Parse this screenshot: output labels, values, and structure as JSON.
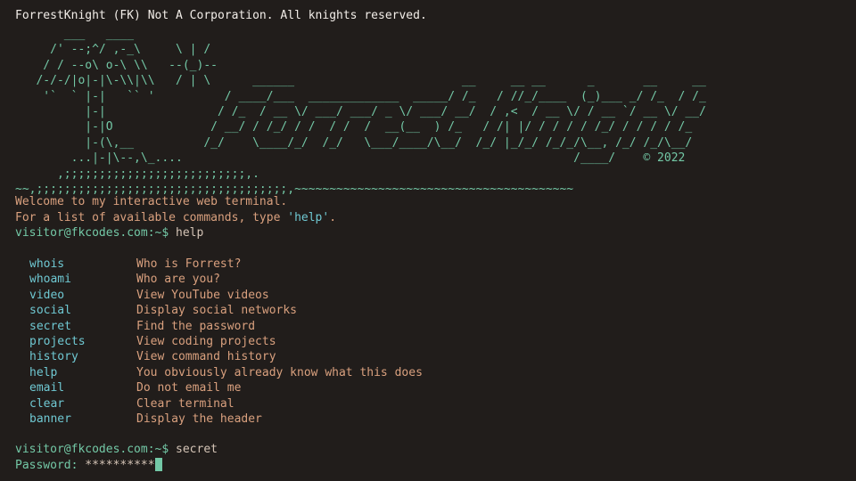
{
  "banner": {
    "copyright_line": "ForrestKnight (FK) Not A Corporation. All knights reserved.",
    "ascii_art": "       ___   ____\n     /' --;^/ ,-_\\     \\ | /\n    / / --o\\ o-\\ \\\\   --(_)--\n   /-/-/|o|-|\\-\\\\|\\\\   / | \\      ______                        __     __ __      _       __     __\n    '`  ` |-|   `` '          / ____/___  _____________  _____/ /_   / //_/____  (_)___ _/ /_  / /_\n          |-|                / /_  / __ \\/ ___/ ___/ _ \\/ ___/ __/  / ,<  / __ \\/ / __ `/ __ \\/ __/\n          |-|O              / __/ / /_/ / /  / /  /  __(__  ) /_   / /| |/ / / / / /_/ / / / / /_\n          |-(\\,__          /_/    \\____/_/  /_/   \\___/____/\\__/  /_/ |_/_/ /_/_/\\__, /_/ /_/\\__/\n        ...|-|\\--,\\_....                                                        /____/    © 2022\n      ,;;;;;;;;;;;;;;;;;;;;;;;;;;,.\n~~,;;;;;;;;;;;;;;;;;;;;;;;;;;;;;;;;;;;;,~~~~~~~~~~~~~~~~~~~~~~~~~~~~~~~~~~~~~~~~",
    "welcome": "Welcome to my interactive web terminal.",
    "help_hint_prefix": "For a list of available commands, type ",
    "help_hint_command": "'help'",
    "help_hint_suffix": "."
  },
  "prompt": "visitor@fkcodes.com:~$",
  "history": [
    {
      "command": "help"
    },
    {
      "command": "secret"
    }
  ],
  "help_commands": [
    {
      "name": "whois",
      "desc": "Who is Forrest?"
    },
    {
      "name": "whoami",
      "desc": "Who are you?"
    },
    {
      "name": "video",
      "desc": "View YouTube videos"
    },
    {
      "name": "social",
      "desc": "Display social networks"
    },
    {
      "name": "secret",
      "desc": "Find the password"
    },
    {
      "name": "projects",
      "desc": "View coding projects"
    },
    {
      "name": "history",
      "desc": "View command history"
    },
    {
      "name": "help",
      "desc": "You obviously already know what this does"
    },
    {
      "name": "email",
      "desc": "Do not email me"
    },
    {
      "name": "clear",
      "desc": "Clear terminal"
    },
    {
      "name": "banner",
      "desc": "Display the header"
    }
  ],
  "password": {
    "label": "Password:",
    "masked_value": "**********"
  },
  "colors": {
    "background": "#211d1b",
    "prompt_green": "#73c8a6",
    "command_cyan": "#6fc8d2",
    "desc_orange": "#d9a07e",
    "text_white": "#f2ede8"
  }
}
